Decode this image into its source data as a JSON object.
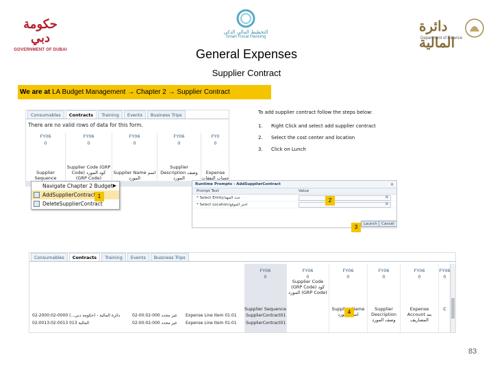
{
  "logos": {
    "left_ar": "حكومة دبي",
    "left_en": "GOVERNMENT OF DUBAI",
    "mid_ar": "التخطيط المالي الذكي",
    "mid_en": "Smart Fiscal Planning",
    "right_ar": "دائرة المالية",
    "right_en": "Department of Finance"
  },
  "title": "General Expenses",
  "subtitle": "Supplier Contract",
  "breadcrumb": {
    "lead": "We are at",
    "path": "LA Budget Management → Chapter 2 → Supplier Contract"
  },
  "screenshot1": {
    "tabs": [
      "Consumables",
      "Contracts",
      "Training",
      "Events",
      "Business Trips"
    ],
    "active_tab": "Contracts",
    "no_data": "There are no valid rows of data for this form.",
    "columns": [
      {
        "h1": "FY06",
        "h2": "0",
        "h3": "Supplier Sequence"
      },
      {
        "h1": "FY06",
        "h2": "0",
        "h3": "Supplier Code (GRP Code) كود المورد (GRP Code)"
      },
      {
        "h1": "FY06",
        "h2": "0",
        "h3": "Supplier Name اسم المورد"
      },
      {
        "h1": "FY06",
        "h2": "0",
        "h3": "Supplier Description وصف المورد"
      },
      {
        "h1": "FY0",
        "h2": "0",
        "h3": "Expense حساب النفقات"
      }
    ],
    "menu": [
      {
        "label": "Navigate Chapter 2 Budget",
        "submenu": "▶"
      },
      {
        "label": "AddSupplierContract"
      },
      {
        "label": "DeleteSupplierContract"
      }
    ]
  },
  "instructions": {
    "intro": "To add supplier contract follow the steps below:",
    "steps": [
      {
        "num": "1.",
        "text": "Right Click and select add supplier contract"
      },
      {
        "num": "2.",
        "text": "Select the cost center and location"
      },
      {
        "num": "3.",
        "text": "Click on Lunch"
      }
    ]
  },
  "dialog": {
    "title": "Runtime Prompts - AddSupplierContract",
    "col_prompt": "Prompt Text",
    "col_value": "Value",
    "rows": [
      {
        "label": "* Select Entity/حدد الجهة"
      },
      {
        "label": "* Select Location/اختر الموقع"
      }
    ],
    "buttons": [
      "Launch",
      "Cancel"
    ]
  },
  "markers": [
    "1",
    "2",
    "3",
    "4"
  ],
  "screenshot2": {
    "tabs": [
      "Consumables",
      "Contracts",
      "Training",
      "Events",
      "Business Trips"
    ],
    "active_tab": "Contracts",
    "columns": [
      {
        "hd1": "FY06\n0",
        "hd2": "",
        "hd3": "Supplier Sequence"
      },
      {
        "hd1": "FY06\n0",
        "hd2": "Supplier Code (GRP Code) كود المورد (GRP Code)",
        "hd3": ""
      },
      {
        "hd1": "FY06\n0",
        "hd2": "",
        "hd3": "Supplier Name اسم المورد"
      },
      {
        "hd1": "FY06\n0",
        "hd2": "",
        "hd3": "Supplier Description وصف المورد"
      },
      {
        "hd1": "FY06\n0",
        "hd2": "",
        "hd3": "Expense Account بند المصاريف"
      },
      {
        "hd1": "FY06\n0",
        "hd2": "",
        "hd3": "C"
      }
    ],
    "rows": [
      {
        "entity": "02-2000:02-0000 دائرة المالية - (حكومة دبي...)",
        "location": "02-00:02-000 غير محدد",
        "line": "Expense Line Item 01:01",
        "seq": "SupplierContract01"
      },
      {
        "entity": "02-0013:02-0013 المالية 013",
        "location": "02-00:02-000 غير محدد",
        "line": "Expense Line Item 01:01",
        "seq": "SupplierContract01"
      }
    ]
  },
  "page_number": "83"
}
